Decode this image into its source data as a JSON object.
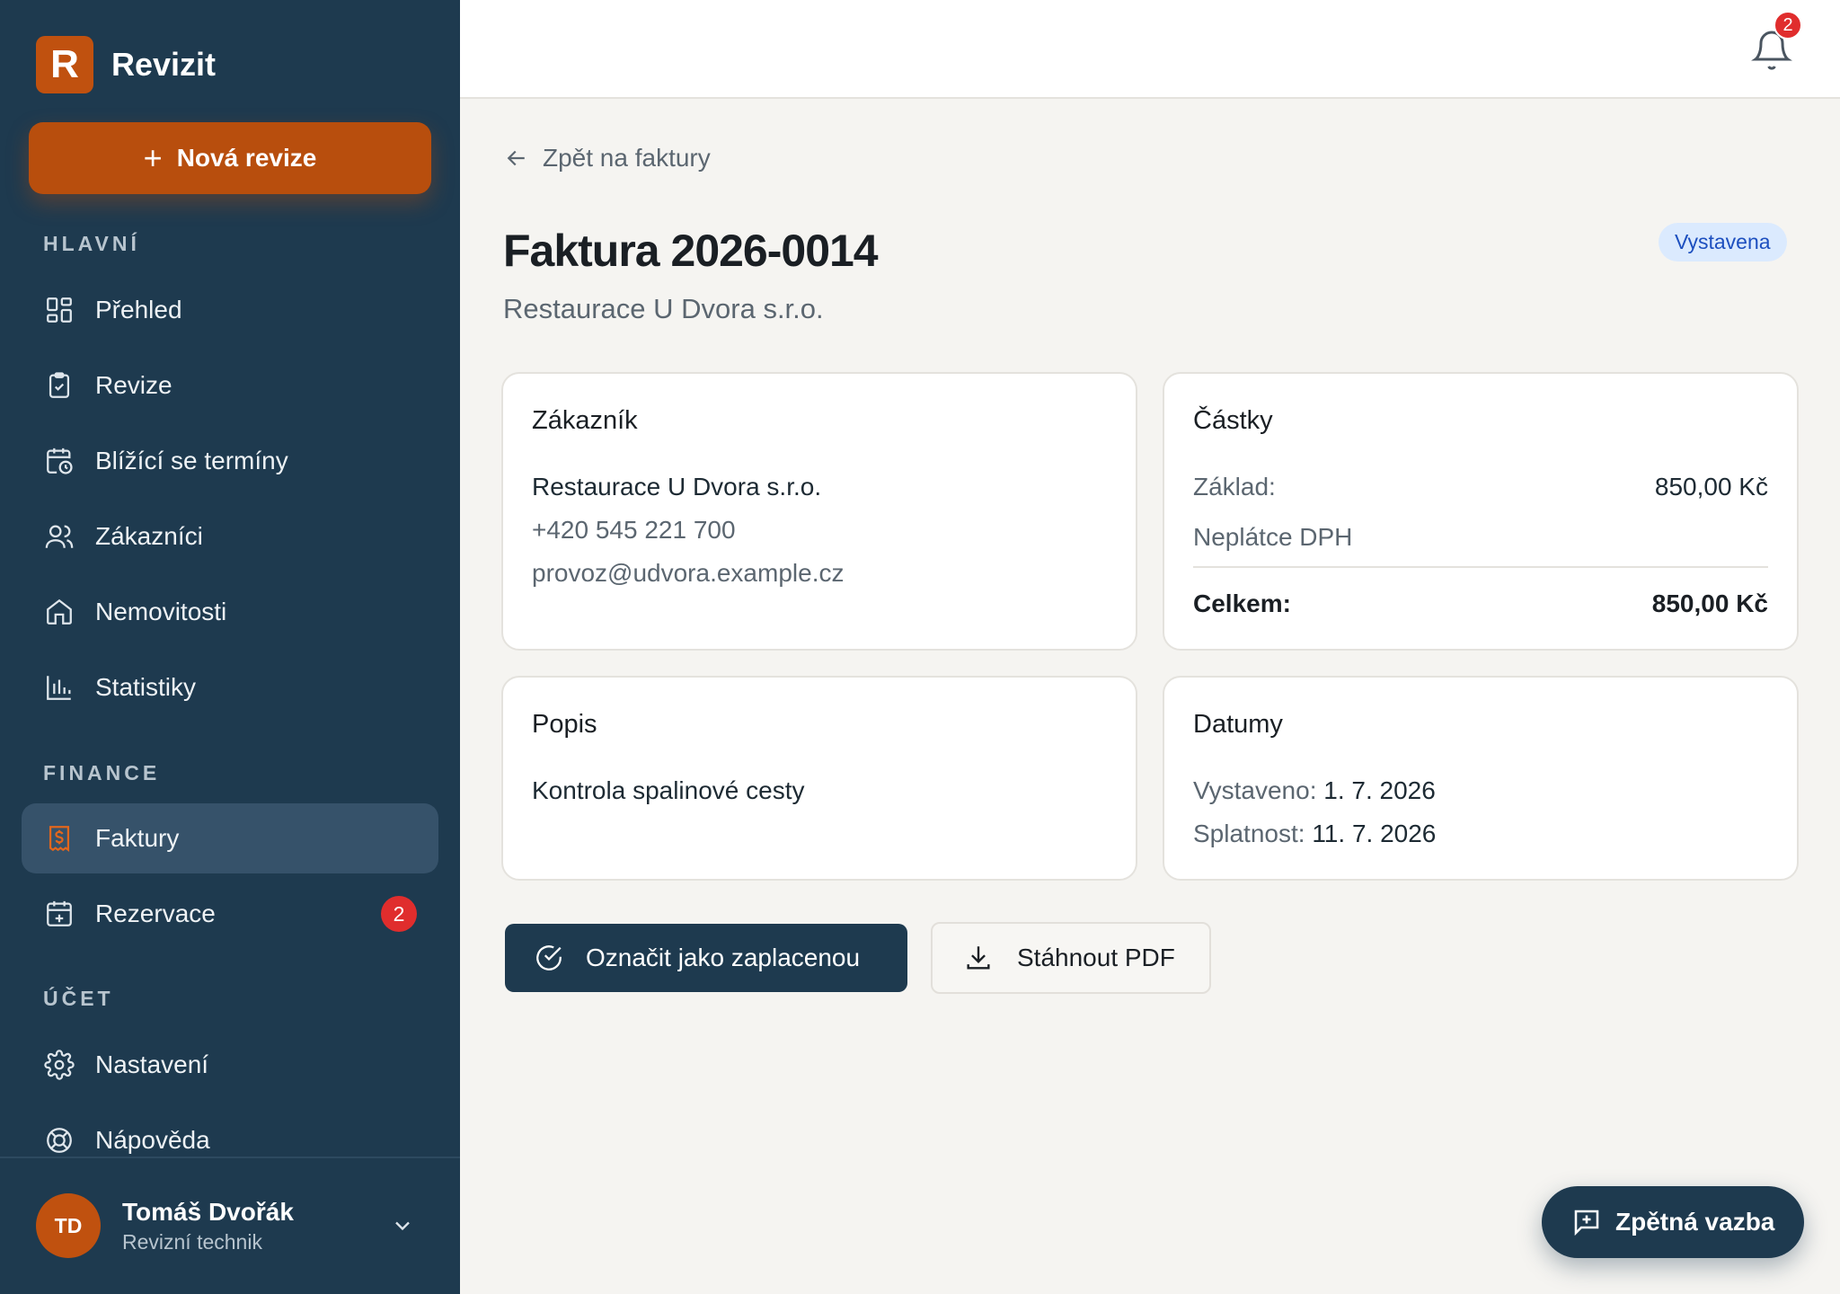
{
  "brand": {
    "logo_letter": "R",
    "name": "Revizit"
  },
  "sidebar": {
    "new_button": {
      "icon": "plus-icon",
      "label": "Nová revize"
    },
    "sections": {
      "main": "HLAVNÍ",
      "finance": "FINANCE",
      "account": "ÚČET"
    },
    "items": [
      {
        "icon": "dashboard-icon",
        "label": "Přehled"
      },
      {
        "icon": "clipboard-check-icon",
        "label": "Revize"
      },
      {
        "icon": "calendar-clock-icon",
        "label": "Blížící se termíny"
      },
      {
        "icon": "users-icon",
        "label": "Zákazníci"
      },
      {
        "icon": "home-icon",
        "label": "Nemovitosti"
      },
      {
        "icon": "bar-chart-icon",
        "label": "Statistiky"
      },
      {
        "icon": "invoice-icon",
        "label": "Faktury",
        "active": true
      },
      {
        "icon": "calendar-plus-icon",
        "label": "Rezervace",
        "badge": "2"
      },
      {
        "icon": "gear-icon",
        "label": "Nastavení"
      },
      {
        "icon": "lifebuoy-icon",
        "label": "Nápověda"
      }
    ],
    "user": {
      "initials": "TD",
      "name": "Tomáš Dvořák",
      "role": "Revizní technik"
    }
  },
  "topbar": {
    "notifications_count": "2"
  },
  "page": {
    "back_link": "Zpět na faktury",
    "title": "Faktura 2026-0014",
    "subtitle": "Restaurace U Dvora s.r.o.",
    "status": "Vystavena"
  },
  "customer_card": {
    "title": "Zákazník",
    "name": "Restaurace U Dvora s.r.o.",
    "phone": "+420 545 221 700",
    "email": "provoz@udvora.example.cz"
  },
  "amounts_card": {
    "title": "Částky",
    "base_label": "Základ:",
    "base_value": "850,00 Kč",
    "vat_note": "Neplátce DPH",
    "total_label": "Celkem:",
    "total_value": "850,00 Kč"
  },
  "description_card": {
    "title": "Popis",
    "text": "Kontrola spalinové cesty"
  },
  "dates_card": {
    "title": "Datumy",
    "issued_label": "Vystaveno:",
    "issued_value": "1. 7. 2026",
    "due_label": "Splatnost:",
    "due_value": "11. 7. 2026"
  },
  "actions": {
    "mark_paid": "Označit jako zaplacenou",
    "download_pdf": "Stáhnout PDF"
  },
  "feedback": {
    "label": "Zpětná vazba"
  },
  "colors": {
    "sidebar_bg": "#1e3a4f",
    "accent": "#b84e0d",
    "badge_red": "#e02d2d",
    "status_bg": "#dbeafe",
    "status_text": "#1d4fbf"
  }
}
